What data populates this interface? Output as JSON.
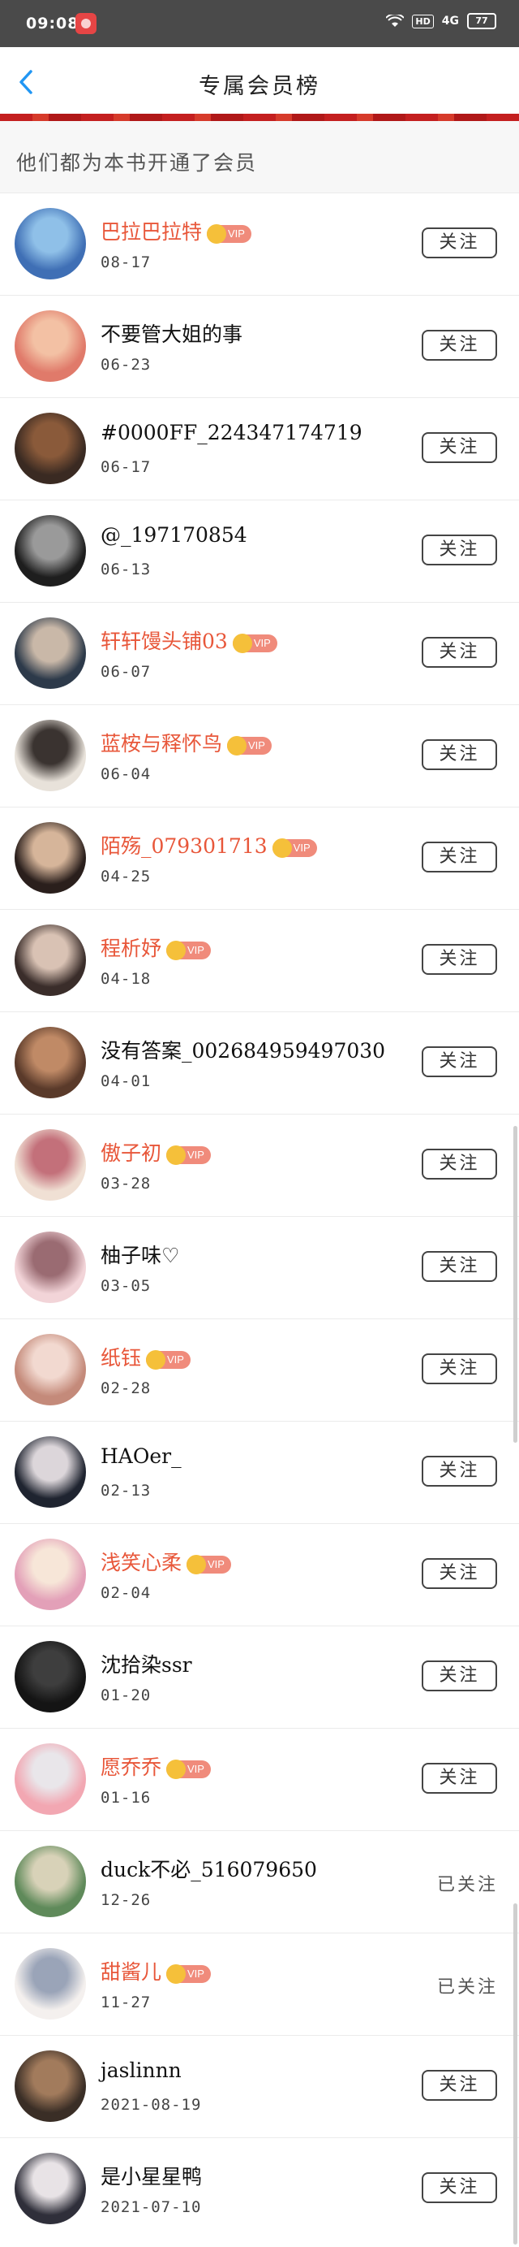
{
  "status_bar": {
    "time": "09:08",
    "hd": "HD",
    "signal": "4G",
    "battery": "77"
  },
  "header": {
    "title": "专属会员榜"
  },
  "subheader": "他们都为本书开通了会员",
  "vip_label": "VIP",
  "follow_label": "关注",
  "followed_label": "已关注",
  "members": [
    {
      "name": "巴拉巴拉特",
      "date": "08-17",
      "vip": true,
      "followed": false,
      "colors": [
        "#3f6fb5",
        "#8fc0e8"
      ]
    },
    {
      "name": "不要管大姐的事",
      "date": "06-23",
      "vip": false,
      "followed": false,
      "colors": [
        "#e07a6a",
        "#f3c1a4"
      ]
    },
    {
      "name": "#0000FF_224347174719",
      "date": "06-17",
      "vip": false,
      "followed": false,
      "colors": [
        "#3a2a22",
        "#8a5a3a"
      ]
    },
    {
      "name": "@_197170854",
      "date": "06-13",
      "vip": false,
      "followed": false,
      "colors": [
        "#1e1e1e",
        "#9a9a9a"
      ]
    },
    {
      "name": "轩轩馒头铺03",
      "date": "06-07",
      "vip": true,
      "followed": false,
      "colors": [
        "#2d3a4a",
        "#c9b8a8"
      ]
    },
    {
      "name": "蓝桉与释怀鸟",
      "date": "06-04",
      "vip": true,
      "followed": false,
      "colors": [
        "#e8e2da",
        "#3a3330"
      ]
    },
    {
      "name": "陌殇_079301713",
      "date": "04-25",
      "vip": true,
      "followed": false,
      "colors": [
        "#2a1f1c",
        "#d6b59a"
      ]
    },
    {
      "name": "程析妤",
      "date": "04-18",
      "vip": true,
      "followed": false,
      "colors": [
        "#3a2d2a",
        "#d9c2b4"
      ]
    },
    {
      "name": "没有答案_002684959497030",
      "date": "04-01",
      "vip": false,
      "followed": false,
      "colors": [
        "#5a3a2a",
        "#c08a66"
      ]
    },
    {
      "name": "傲子初",
      "date": "03-28",
      "vip": true,
      "followed": false,
      "colors": [
        "#f0e0d4",
        "#c3707a"
      ]
    },
    {
      "name": "柚子味♡",
      "date": "03-05",
      "vip": false,
      "followed": false,
      "colors": [
        "#f2d4d8",
        "#9a6b72"
      ]
    },
    {
      "name": "纸钰",
      "date": "02-28",
      "vip": true,
      "followed": false,
      "colors": [
        "#c48a7a",
        "#f2d9d0"
      ]
    },
    {
      "name": "HAOer_",
      "date": "02-13",
      "vip": false,
      "followed": false,
      "colors": [
        "#1f2430",
        "#dcd6da"
      ]
    },
    {
      "name": "浅笑心柔",
      "date": "02-04",
      "vip": true,
      "followed": false,
      "colors": [
        "#e3a0b8",
        "#f7e6d8"
      ]
    },
    {
      "name": "沈拾染ssr",
      "date": "01-20",
      "vip": false,
      "followed": false,
      "colors": [
        "#141414",
        "#3e3e3e"
      ]
    },
    {
      "name": "愿乔乔",
      "date": "01-16",
      "vip": true,
      "followed": false,
      "colors": [
        "#f2a7b2",
        "#e9e6ea"
      ]
    },
    {
      "name": "duck不必_516079650",
      "date": "12-26",
      "vip": false,
      "followed": true,
      "colors": [
        "#5f8a5a",
        "#d8d2b8"
      ]
    },
    {
      "name": "甜酱儿",
      "date": "11-27",
      "vip": true,
      "followed": true,
      "colors": [
        "#f4f0ee",
        "#9aa4b8"
      ]
    },
    {
      "name": "jaslinnn",
      "date": "2021-08-19",
      "vip": false,
      "followed": false,
      "colors": [
        "#3a2e26",
        "#a27b5c"
      ]
    },
    {
      "name": "是小星星鸭",
      "date": "2021-07-10",
      "vip": false,
      "followed": false,
      "colors": [
        "#2f2f3a",
        "#e8e3e6"
      ]
    }
  ]
}
